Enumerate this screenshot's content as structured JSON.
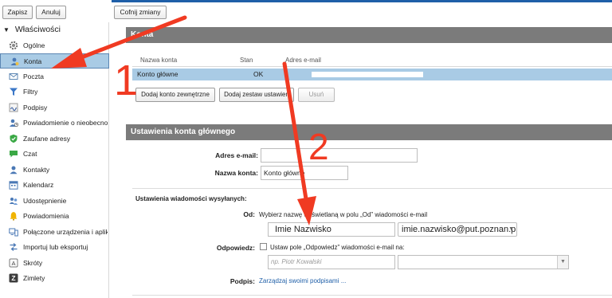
{
  "toolbar": {
    "save_label": "Zapisz",
    "cancel_label": "Anuluj",
    "undo_label": "Cofnij zmiany"
  },
  "sidebar": {
    "header": "Właściwości",
    "items": [
      {
        "label": "Ogólne",
        "icon": "gear-icon"
      },
      {
        "label": "Konta",
        "icon": "account-icon"
      },
      {
        "label": "Poczta",
        "icon": "mail-icon"
      },
      {
        "label": "Filtry",
        "icon": "filter-icon"
      },
      {
        "label": "Podpisy",
        "icon": "signature-icon"
      },
      {
        "label": "Powiadomienie o nieobecności",
        "icon": "absence-icon"
      },
      {
        "label": "Zaufane adresy",
        "icon": "shield-icon"
      },
      {
        "label": "Czat",
        "icon": "chat-icon"
      },
      {
        "label": "Kontakty",
        "icon": "contacts-icon"
      },
      {
        "label": "Kalendarz",
        "icon": "calendar-icon"
      },
      {
        "label": "Udostępnienie",
        "icon": "share-icon"
      },
      {
        "label": "Powiadomienia",
        "icon": "bell-icon"
      },
      {
        "label": "Połączone urządzenia i aplikacje",
        "icon": "devices-icon"
      },
      {
        "label": "Importuj lub eksportuj",
        "icon": "import-export-icon"
      },
      {
        "label": "Skróty",
        "icon": "shortcuts-icon"
      },
      {
        "label": "Zimlety",
        "icon": "zimlet-icon"
      }
    ]
  },
  "accounts": {
    "section_title": "Konta",
    "columns": [
      "Nazwa konta",
      "Stan",
      "Adres e-mail"
    ],
    "rows": [
      {
        "name": "Konto główne",
        "status": "OK",
        "email": ""
      }
    ],
    "add_external_label": "Dodaj konto zewnętrzne",
    "add_set_label": "Dodaj zestaw ustawień",
    "delete_label": "Usuń"
  },
  "main_account": {
    "section_title": "Ustawienia konta głównego",
    "email_label": "Adres e-mail:",
    "email_value": "",
    "account_name_label": "Nazwa konta:",
    "account_name_value": "Konto główne",
    "sending_header": "Ustawienia wiadomości wysyłanych:",
    "from_label": "Od:",
    "from_hint": "Wybierz nazwę wyświetlaną w polu „Od” wiadomości e-mail",
    "from_name_value": "Imie Nazwisko",
    "from_email_value": "imie.nazwisko@put.poznan.pl",
    "reply_label": "Odpowiedz:",
    "reply_checkbox_text": "Ustaw pole „Odpowiedz” wiadomości e-mail na:",
    "reply_name_placeholder": "np. Piotr Kowalski",
    "signature_label": "Podpis:",
    "signature_link": "Zarządzaj swoimi podpisami ..."
  },
  "annotations": {
    "marker_1": "1",
    "marker_2": "2",
    "color": "#f03a22"
  }
}
